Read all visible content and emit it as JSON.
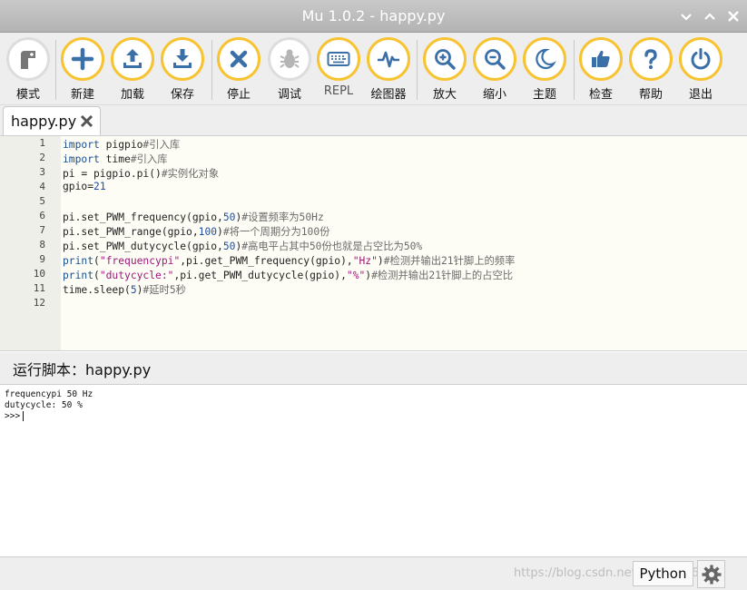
{
  "window": {
    "title": "Mu 1.0.2 - happy.py"
  },
  "toolbar": {
    "buttons": [
      {
        "label": "模式",
        "icon": "mode-icon"
      },
      {
        "label": "新建",
        "icon": "plus-icon"
      },
      {
        "label": "加载",
        "icon": "upload-icon"
      },
      {
        "label": "保存",
        "icon": "download-icon"
      },
      {
        "label": "停止",
        "icon": "x-icon"
      },
      {
        "label": "调试",
        "icon": "bug-icon"
      },
      {
        "label": "REPL",
        "icon": "keyboard-icon"
      },
      {
        "label": "绘图器",
        "icon": "pulse-icon"
      },
      {
        "label": "放大",
        "icon": "zoom-in-icon"
      },
      {
        "label": "缩小",
        "icon": "zoom-out-icon"
      },
      {
        "label": "主题",
        "icon": "moon-icon"
      },
      {
        "label": "检查",
        "icon": "thumbs-up-icon"
      },
      {
        "label": "帮助",
        "icon": "question-icon"
      },
      {
        "label": "退出",
        "icon": "power-icon"
      }
    ]
  },
  "tabs": [
    {
      "name": "happy.py"
    }
  ],
  "editor": {
    "line_numbers": [
      "1",
      "2",
      "3",
      "4",
      "5",
      "6",
      "7",
      "8",
      "9",
      "10",
      "11",
      "12"
    ],
    "lines": [
      [
        {
          "t": "import",
          "c": "kw"
        },
        {
          "t": " pigpio",
          "c": "id"
        },
        {
          "t": "#引入库",
          "c": "cmt"
        }
      ],
      [
        {
          "t": "import",
          "c": "kw"
        },
        {
          "t": " time",
          "c": "id"
        },
        {
          "t": "#引入库",
          "c": "cmt"
        }
      ],
      [
        {
          "t": "pi = pigpio.pi()",
          "c": "id"
        },
        {
          "t": "#实例化对象",
          "c": "cmt"
        }
      ],
      [
        {
          "t": "gpio=",
          "c": "id"
        },
        {
          "t": "21",
          "c": "num"
        }
      ],
      [],
      [
        {
          "t": "pi.set_PWM_frequency(gpio,",
          "c": "id"
        },
        {
          "t": "50",
          "c": "num"
        },
        {
          "t": ")",
          "c": "id"
        },
        {
          "t": "#设置频率为50Hz",
          "c": "cmt"
        }
      ],
      [
        {
          "t": "pi.set_PWM_range(gpio,",
          "c": "id"
        },
        {
          "t": "100",
          "c": "num"
        },
        {
          "t": ")",
          "c": "id"
        },
        {
          "t": "#将一个周期分为100份",
          "c": "cmt"
        }
      ],
      [
        {
          "t": "pi.set_PWM_dutycycle(gpio,",
          "c": "id"
        },
        {
          "t": "50",
          "c": "num"
        },
        {
          "t": ")",
          "c": "id"
        },
        {
          "t": "#高电平占其中50份也就是占空比为50%",
          "c": "cmt"
        }
      ],
      [
        {
          "t": "print",
          "c": "kw"
        },
        {
          "t": "(",
          "c": "id"
        },
        {
          "t": "\"frequencypi\"",
          "c": "str"
        },
        {
          "t": ",pi.get_PWM_frequency(gpio),",
          "c": "id"
        },
        {
          "t": "\"Hz\"",
          "c": "str"
        },
        {
          "t": ")",
          "c": "id"
        },
        {
          "t": "#检测并输出21针脚上的频率",
          "c": "cmt"
        }
      ],
      [
        {
          "t": "print",
          "c": "kw"
        },
        {
          "t": "(",
          "c": "id"
        },
        {
          "t": "\"dutycycle:\"",
          "c": "str"
        },
        {
          "t": ",pi.get_PWM_dutycycle(gpio),",
          "c": "id"
        },
        {
          "t": "\"%\"",
          "c": "str"
        },
        {
          "t": ")",
          "c": "id"
        },
        {
          "t": "#检测并输出21针脚上的占空比",
          "c": "cmt"
        }
      ],
      [
        {
          "t": "time.sleep(",
          "c": "id"
        },
        {
          "t": "5",
          "c": "num"
        },
        {
          "t": ")",
          "c": "id"
        },
        {
          "t": "#延时5秒",
          "c": "cmt"
        }
      ],
      []
    ]
  },
  "run_panel": {
    "header": "运行脚本：happy.py",
    "output": [
      "frequencypi 50 Hz",
      "dutycycle: 50 %"
    ],
    "prompt": ">>>"
  },
  "status": {
    "mode": "Python",
    "watermark": "https://blog.csdn.net/weixin_46...37"
  },
  "colors": {
    "accent_ring": "#f7c331",
    "icon_blue": "#3b6fa8",
    "editor_bg": "#fefdf5"
  }
}
